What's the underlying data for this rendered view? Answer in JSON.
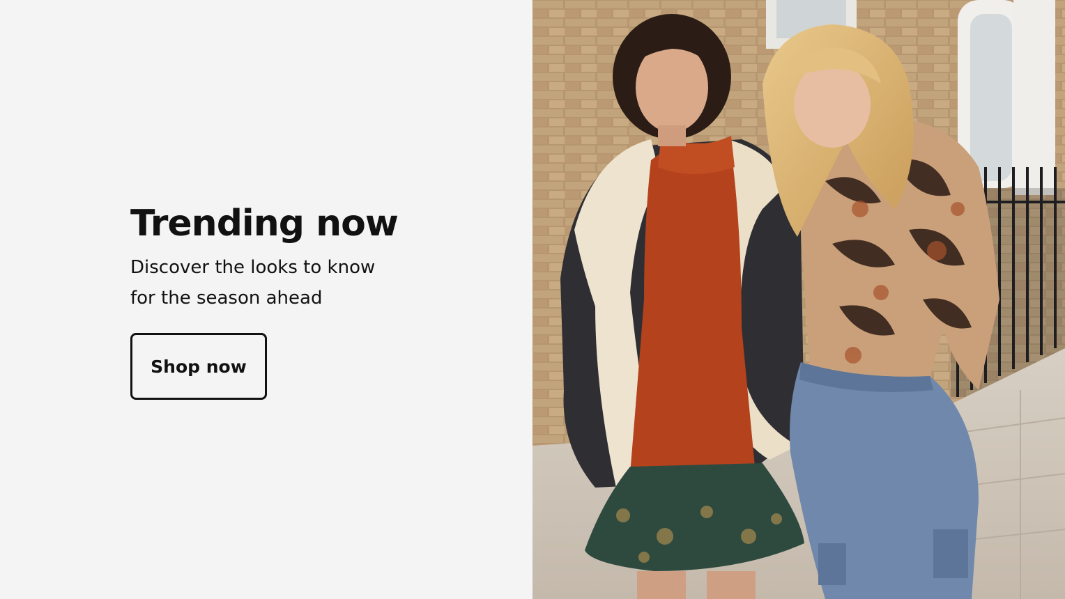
{
  "hero": {
    "headline": "Trending now",
    "subhead": "Discover the looks to know for the season ahead",
    "cta_label": "Shop now"
  },
  "colors": {
    "panel_background": "#f4f4f4",
    "text": "#111111",
    "button_border": "#111111"
  },
  "image": {
    "subject": "two-women-walking-street-photo"
  }
}
